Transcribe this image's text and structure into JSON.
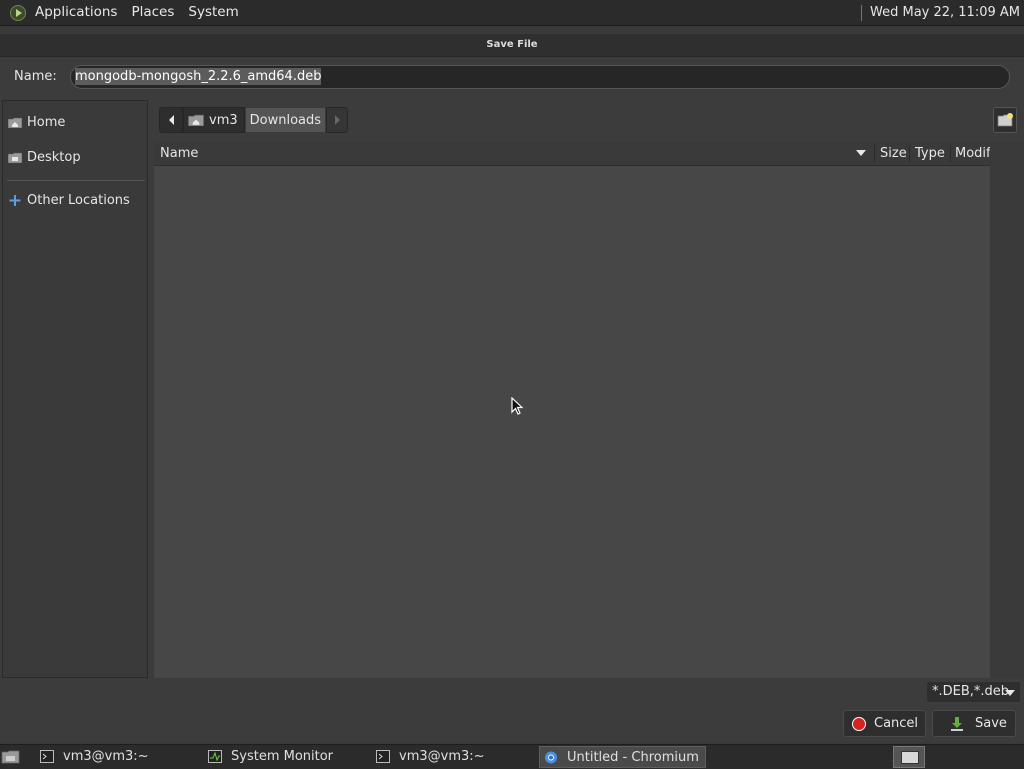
{
  "top_panel": {
    "menus": [
      "Applications",
      "Places",
      "System"
    ],
    "clock": "Wed May 22, 11:09 AM"
  },
  "dialog": {
    "title": "Save File",
    "name_label": "Name:",
    "filename": "mongodb-mongosh_2.2.6_amd64.deb",
    "sidebar": [
      {
        "label": "Home",
        "icon": "home-folder-icon"
      },
      {
        "label": "Desktop",
        "icon": "desktop-folder-icon"
      },
      {
        "label": "Other Locations",
        "icon": "plus-icon"
      }
    ],
    "path": [
      "vm3",
      "Downloads"
    ],
    "columns": {
      "name": "Name",
      "size": "Size",
      "type": "Type",
      "modified": "Modif"
    },
    "filter": "*.DEB,*.deb",
    "cancel_label": "Cancel",
    "save_label": "Save"
  },
  "taskbar": {
    "tasks": [
      {
        "label": "vm3@vm3:~",
        "icon": "terminal-icon",
        "active": false
      },
      {
        "label": "System Monitor",
        "icon": "system-monitor-icon",
        "active": false
      },
      {
        "label": "vm3@vm3:~",
        "icon": "terminal-icon",
        "active": false
      },
      {
        "label": "Untitled - Chromium",
        "icon": "chromium-icon",
        "active": true
      }
    ]
  },
  "colors": {
    "accent_selection": "#5c5c5c",
    "cancel_red": "#d42323",
    "save_green": "#5fb040"
  }
}
